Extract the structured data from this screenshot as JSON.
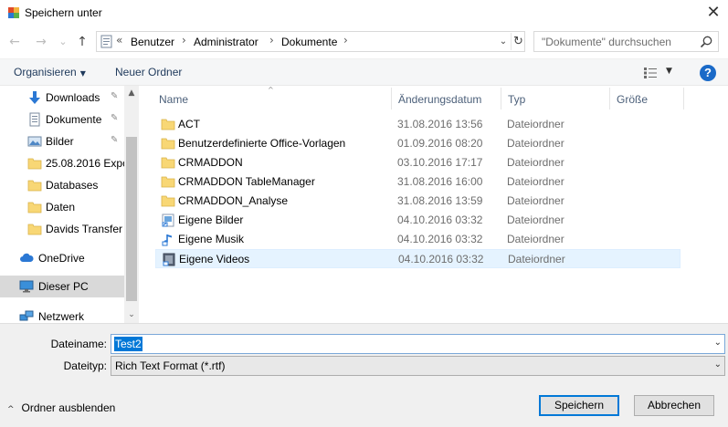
{
  "window": {
    "title": "Speichern unter",
    "close_glyph": "✕"
  },
  "navigation": {
    "back_glyph": "←",
    "forward_glyph": "→",
    "history_glyph": "⌄",
    "up_glyph": "↑"
  },
  "address": {
    "overflow_glyph": "«",
    "crumbs": [
      "Benutzer",
      "Administrator",
      "Dokumente"
    ],
    "separator_glyph": "›",
    "dropdown_glyph": "⌄",
    "refresh_glyph": "↻"
  },
  "search": {
    "placeholder": "\"Dokumente\" durchsuchen",
    "icon": "search-icon"
  },
  "toolbar": {
    "organize_label": "Organisieren",
    "organize_caret": "▼",
    "new_folder_label": "Neuer Ordner",
    "view_caret": "▼",
    "help_label": "?"
  },
  "sidebar": {
    "pin_glyph": "📌",
    "items": [
      {
        "label": "Downloads",
        "icon": "download-arrow-icon",
        "pinned": true
      },
      {
        "label": "Dokumente",
        "icon": "documents-icon",
        "pinned": true
      },
      {
        "label": "Bilder",
        "icon": "pictures-icon",
        "pinned": true
      },
      {
        "label": "25.08.2016 Expor",
        "icon": "folder-icon",
        "pinned": false
      },
      {
        "label": "Databases",
        "icon": "folder-icon",
        "pinned": false
      },
      {
        "label": "Daten",
        "icon": "folder-icon",
        "pinned": false
      },
      {
        "label": "Davids Transfer",
        "icon": "folder-icon",
        "pinned": false
      },
      {
        "label": "OneDrive",
        "icon": "cloud-icon",
        "pinned": false
      },
      {
        "label": "Dieser PC",
        "icon": "computer-icon",
        "pinned": false,
        "selected": true
      },
      {
        "label": "Netzwerk",
        "icon": "network-icon",
        "pinned": false
      }
    ],
    "scroll_up_glyph": "▲",
    "scroll_down_glyph": "⌄"
  },
  "columns": {
    "name": "Name",
    "date": "Änderungsdatum",
    "type": "Typ",
    "size": "Größe",
    "sort_glyph": "^"
  },
  "files": [
    {
      "name": "ACT",
      "date": "31.08.2016 13:56",
      "type": "Dateiordner",
      "icon": "folder-icon"
    },
    {
      "name": "Benutzerdefinierte Office-Vorlagen",
      "date": "01.09.2016 08:20",
      "type": "Dateiordner",
      "icon": "folder-icon"
    },
    {
      "name": "CRMADDON",
      "date": "03.10.2016 17:17",
      "type": "Dateiordner",
      "icon": "folder-icon"
    },
    {
      "name": "CRMADDON TableManager",
      "date": "31.08.2016 16:00",
      "type": "Dateiordner",
      "icon": "folder-icon"
    },
    {
      "name": "CRMADDON_Analyse",
      "date": "31.08.2016 13:59",
      "type": "Dateiordner",
      "icon": "folder-icon"
    },
    {
      "name": "Eigene Bilder",
      "date": "04.10.2016 03:32",
      "type": "Dateiordner",
      "icon": "pictures-shortcut-icon"
    },
    {
      "name": "Eigene Musik",
      "date": "04.10.2016 03:32",
      "type": "Dateiordner",
      "icon": "music-shortcut-icon"
    },
    {
      "name": "Eigene Videos",
      "date": "04.10.2016 03:32",
      "type": "Dateiordner",
      "icon": "videos-shortcut-icon",
      "selected": true
    }
  ],
  "form": {
    "filename_label": "Dateiname:",
    "filename_value": "Test2",
    "filetype_label": "Dateityp:",
    "filetype_value": "Rich Text Format (*.rtf)",
    "dropdown_glyph": "⌄",
    "hide_folders_label": "Ordner ausblenden",
    "hide_folders_glyph": "^",
    "save_label": "Speichern",
    "cancel_label": "Abbrechen"
  },
  "colors": {
    "accent": "#0078d7",
    "folder": "#f8d775",
    "help": "#1a6ac8",
    "selected_row": "#e5f3ff"
  }
}
